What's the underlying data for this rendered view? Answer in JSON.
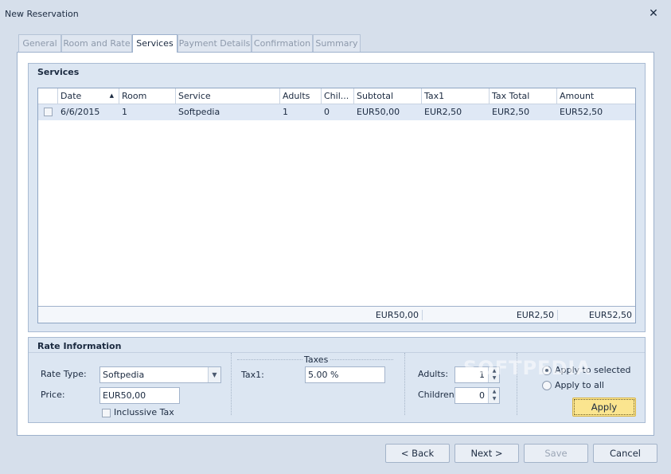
{
  "window": {
    "title": "New Reservation",
    "close_glyph": "✕"
  },
  "tabs": [
    {
      "label": "General",
      "active": false
    },
    {
      "label": "Room and Rate",
      "active": false
    },
    {
      "label": "Services",
      "active": true
    },
    {
      "label": "Payment Details",
      "active": false
    },
    {
      "label": "Confirmation",
      "active": false
    },
    {
      "label": "Summary",
      "active": false
    }
  ],
  "services": {
    "heading": "Services",
    "columns": [
      "Date",
      "Room",
      "Service",
      "Adults",
      "Chil...",
      "Subtotal",
      "Tax1",
      "Tax Total",
      "Amount"
    ],
    "sort_glyph": "▲",
    "rows": [
      {
        "date": "6/6/2015",
        "room": "1",
        "service": "Softpedia",
        "adults": "1",
        "children": "0",
        "subtotal": "EUR50,00",
        "tax1": "EUR2,50",
        "tax_total": "EUR2,50",
        "amount": "EUR52,50"
      }
    ],
    "totals": {
      "subtotal": "EUR50,00",
      "tax_total": "EUR2,50",
      "amount": "EUR52,50"
    }
  },
  "rate_info": {
    "heading": "Rate Information",
    "rate_type_label": "Rate Type:",
    "rate_type_value": "Softpedia",
    "price_label": "Price:",
    "price_value": "EUR50,00",
    "inclusive_tax_label": "Inclussive Tax",
    "taxes_heading": "Taxes",
    "tax1_label": "Tax1:",
    "tax1_value": "5.00 %",
    "adults_label": "Adults:",
    "adults_value": "1",
    "children_label": "Children:",
    "children_value": "0",
    "apply_selected_label": "Apply to selected",
    "apply_all_label": "Apply to all",
    "apply_selected_checked": true,
    "apply_button": "Apply"
  },
  "footer_buttons": {
    "back": "< Back",
    "next": "Next >",
    "save": "Save",
    "cancel": "Cancel"
  },
  "watermark": "SOFTPEDIA",
  "colors": {
    "window_bg": "#d6dfeb",
    "group_bg": "#dce6f2",
    "row_selected": "#dfe8f5",
    "apply_button": "#fbe58f"
  }
}
